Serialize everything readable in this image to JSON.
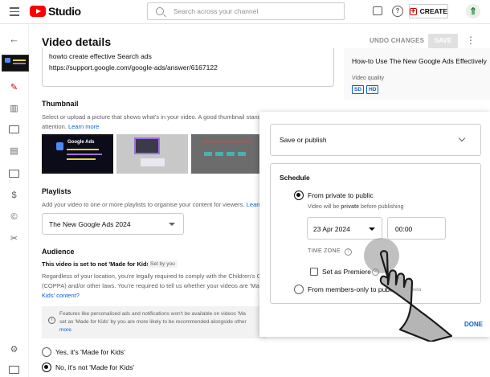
{
  "topbar": {
    "brand": "Studio",
    "search_placeholder": "Search across your channel",
    "create_label": "CREATE",
    "avatar_glyph": "⇑"
  },
  "header": {
    "title": "Video details",
    "undo_label": "UNDO CHANGES",
    "save_label": "SAVE"
  },
  "description": {
    "line1": "howto create effective Search ads",
    "line2": "https://support.google.com/google-ads/answer/6167122"
  },
  "preview": {
    "video_title": "How-to Use The New Google Ads Effectively",
    "quality_label": "Video quality",
    "badges": [
      "SD",
      "HD"
    ]
  },
  "thumbnail": {
    "heading": "Thumbnail",
    "text_line1": "Select or upload a picture that shows what's in your video. A good thumbnail stands",
    "text_line2": "attention.",
    "learn_more": "Learn more",
    "thumb1_title": "Google Ads"
  },
  "playlists": {
    "heading": "Playlists",
    "text": "Add your video to one or more playlists to organise your content for viewers.",
    "link": "Learn",
    "selected": "The New Google Ads 2024"
  },
  "audience": {
    "heading": "Audience",
    "status": "This video is set to not 'Made for Kids'",
    "status_tag": "Set by you",
    "para_line1": "Regardless of your location, you're legally required to comply with the Children's On",
    "para_line2": "(COPPA) and/or other laws. You're required to tell us whether your videos are 'Made",
    "para_line3": "Kids' content?",
    "note_line1": "Features like personalised ads and notifications won't be available on videos 'Ma",
    "note_line2": "set as 'Made for Kids' by you are more likely to be recommended alongside other",
    "note_line3": "more",
    "option_yes": "Yes, it's 'Made for Kids'",
    "option_no": "No, it's not 'Made for Kids'"
  },
  "visibility_popup": {
    "save_or_publish": "Save or publish",
    "schedule_title": "Schedule",
    "option_private_to_public": "From private to public",
    "note_prefix": "Video will be ",
    "note_bold": "private",
    "note_suffix": " before publishing",
    "date": "23 Apr 2024",
    "time": "00:00",
    "time_zone_label": "TIME ZONE",
    "premiere_label": "Set as Premiere",
    "option_members_to_public": "From members-only to public",
    "members_tag": "Beta",
    "done_label": "DONE"
  },
  "colors": {
    "brand_red": "#ff0000",
    "link_blue": "#065fd4",
    "active_nav": "#cc0000"
  }
}
